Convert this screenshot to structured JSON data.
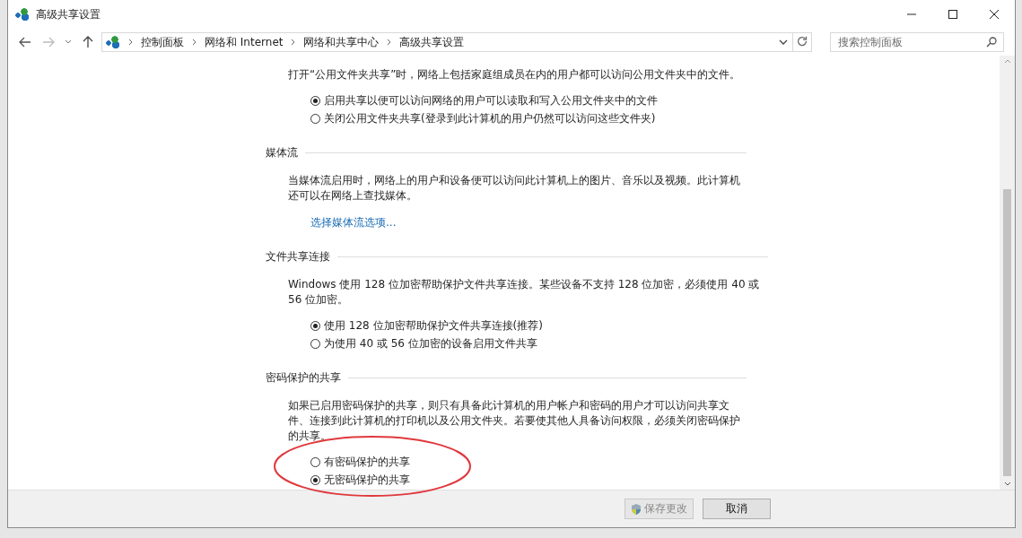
{
  "window": {
    "title": "高级共享设置"
  },
  "navigation": {
    "back": {
      "disabled": false
    },
    "forward": {
      "disabled": true
    }
  },
  "address_bar": {
    "breadcrumbs": [
      "控制面板",
      "网络和 Internet",
      "网络和共享中心",
      "高级共享设置"
    ]
  },
  "search": {
    "placeholder": "搜索控制面板"
  },
  "sections": [
    {
      "description": "打开“公用文件夹共享”时，网络上包括家庭组成员在内的用户都可以访问公用文件夹中的文件。",
      "options": [
        {
          "label": "启用共享以便可以访问网络的用户可以读取和写入公用文件夹中的文件",
          "selected": true
        },
        {
          "label": "关闭公用文件夹共享(登录到此计算机的用户仍然可以访问这些文件夹)",
          "selected": false
        }
      ]
    },
    {
      "title": "媒体流",
      "description": "当媒体流启用时，网络上的用户和设备便可以访问此计算机上的图片、音乐以及视频。此计算机还可以在网络上查找媒体。",
      "link": "选择媒体流选项..."
    },
    {
      "title": "文件共享连接",
      "description": "Windows 使用 128 位加密帮助保护文件共享连接。某些设备不支持 128 位加密，必须使用 40 或 56 位加密。",
      "options": [
        {
          "label": "使用 128 位加密帮助保护文件共享连接(推荐)",
          "selected": true
        },
        {
          "label": "为使用 40 或 56 位加密的设备启用文件共享",
          "selected": false
        }
      ]
    },
    {
      "title": "密码保护的共享",
      "description": "如果已启用密码保护的共享，则只有具备此计算机的用户帐户和密码的用户才可以访问共享文件、连接到此计算机的打印机以及公用文件夹。若要使其他人具备访问权限，必须关闭密码保护的共享。",
      "options": [
        {
          "label": "有密码保护的共享",
          "selected": false
        },
        {
          "label": "无密码保护的共享",
          "selected": true
        }
      ]
    }
  ],
  "buttons": [
    {
      "label": "保存更改",
      "disabled": true,
      "shield": true
    },
    {
      "label": "取消",
      "disabled": false,
      "shield": false
    }
  ]
}
